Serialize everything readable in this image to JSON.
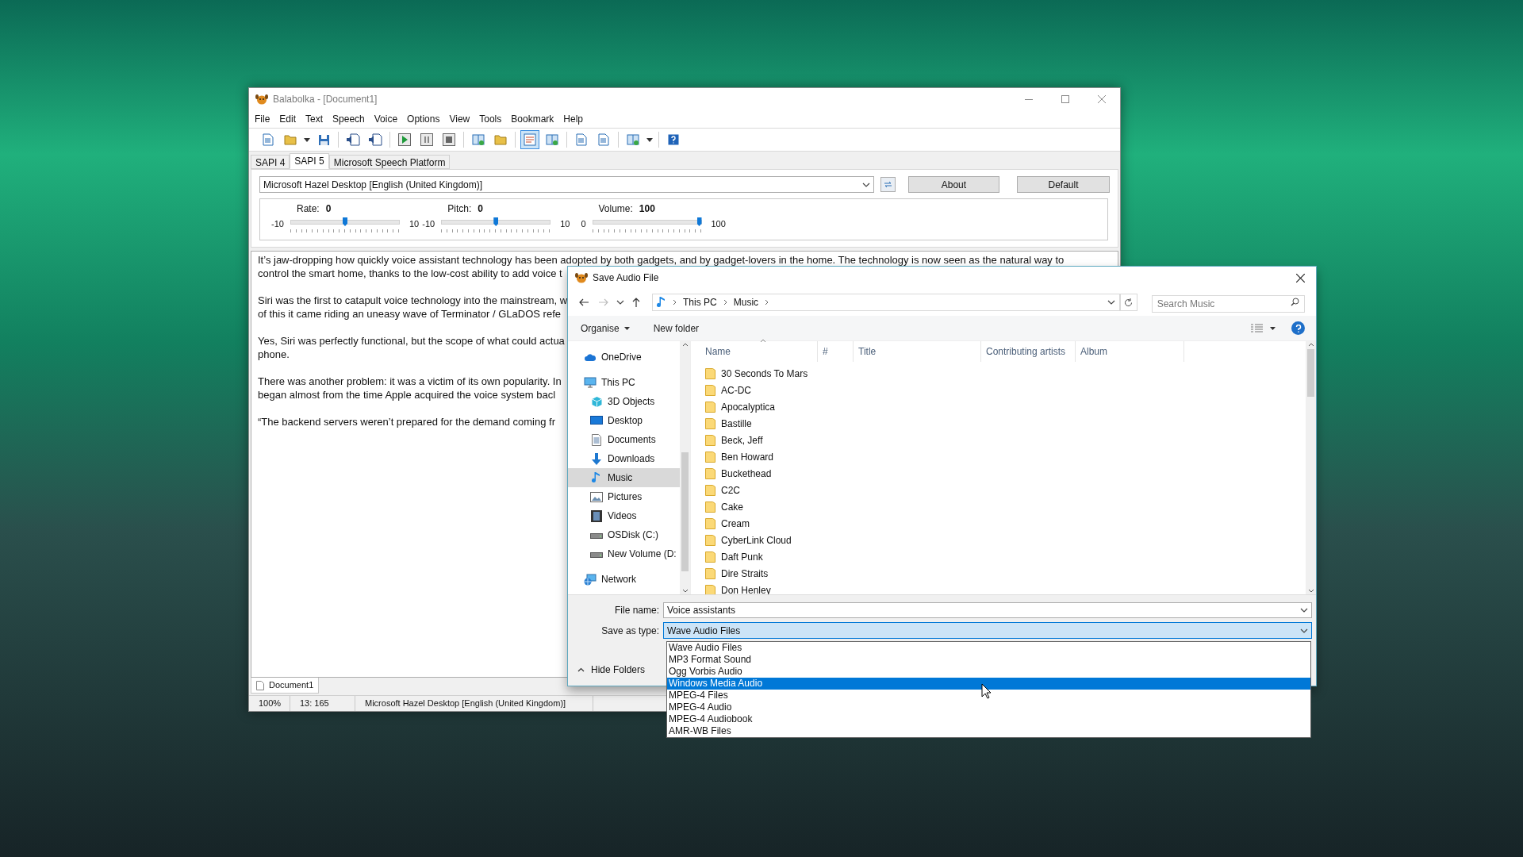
{
  "balabolka": {
    "title": "Balabolka - [Document1]",
    "menu": [
      "File",
      "Edit",
      "Text",
      "Speech",
      "Voice",
      "Options",
      "View",
      "Tools",
      "Bookmark",
      "Help"
    ],
    "toolbar": [
      {
        "kind": "page",
        "pressed": false
      },
      {
        "kind": "folder",
        "pressed": false
      },
      {
        "kind": "caret"
      },
      {
        "kind": "floppy",
        "pressed": false
      },
      {
        "kind": "sep"
      },
      {
        "kind": "page-speaker",
        "pressed": false
      },
      {
        "kind": "page-speaker",
        "pressed": false
      },
      {
        "kind": "sep"
      },
      {
        "kind": "play",
        "pressed": false
      },
      {
        "kind": "pause",
        "pressed": false
      },
      {
        "kind": "stop",
        "pressed": false
      },
      {
        "kind": "sep"
      },
      {
        "kind": "book",
        "pressed": false
      },
      {
        "kind": "folder",
        "pressed": false
      },
      {
        "kind": "sep"
      },
      {
        "kind": "panel",
        "pressed": true
      },
      {
        "kind": "book",
        "pressed": false
      },
      {
        "kind": "sep"
      },
      {
        "kind": "page",
        "pressed": false
      },
      {
        "kind": "page",
        "pressed": false
      },
      {
        "kind": "sep"
      },
      {
        "kind": "book",
        "pressed": false
      },
      {
        "kind": "caret"
      },
      {
        "kind": "sep"
      },
      {
        "kind": "help",
        "pressed": false
      }
    ],
    "engine_tabs": [
      {
        "label": "SAPI 4",
        "selected": false
      },
      {
        "label": "SAPI 5",
        "selected": true
      },
      {
        "label": "Microsoft Speech Platform",
        "selected": false
      }
    ],
    "voice": "Microsoft Hazel Desktop [English (United Kingdom)]",
    "buttons": [
      "About",
      "Default"
    ],
    "sliders": [
      {
        "label": "Rate:",
        "value": "0",
        "min": "-10",
        "max": "10",
        "level": 0.5
      },
      {
        "label": "Pitch:",
        "value": "0",
        "min": "-10",
        "max": "10",
        "level": 0.5
      },
      {
        "label": "Volume:",
        "value": "100",
        "min": "0",
        "max": "100",
        "level": 1
      }
    ],
    "text_paragraphs": [
      [
        "It’s jaw-dropping how quickly voice assistant technology has been adopted by both gadgets, and by gadget-lovers in the home. The technology is now seen as the natural way to",
        "control the smart home, thanks to the low-cost ability to add voice t"
      ],
      [
        "Siri was the first to catapult voice technology into the mainstream, w",
        "of this it came riding an uneasy wave of Terminator / GLaDOS refe"
      ],
      [
        "Yes, Siri was perfectly functional, but the scope of what could actua",
        "phone."
      ],
      [
        "There was another problem: it was a victim of its own popularity. In",
        "began almost from the time Apple acquired the voice system bacl"
      ],
      [
        "“The backend servers weren’t prepared for the demand coming fr"
      ]
    ],
    "document_tabs": [
      {
        "label": "Document1",
        "selected": true
      }
    ],
    "status_bar": [
      "100%",
      "13: 165",
      "Microsoft Hazel Desktop [English (United Kingdom)]"
    ]
  },
  "save_dialog": {
    "title": "Save Audio File",
    "breadcrumb": [
      "This PC",
      "Music"
    ],
    "search": {
      "placeholder": "Search Music"
    },
    "commands": [
      "Organise",
      "New folder"
    ],
    "sidebar": [
      {
        "label": "OneDrive",
        "kind": "cloud",
        "selected": false
      },
      {
        "label": "This PC",
        "kind": "computer",
        "selected": false,
        "children": [
          {
            "label": "3D Objects",
            "kind": "cube",
            "selected": false
          },
          {
            "label": "Desktop",
            "kind": "desktop",
            "selected": false
          },
          {
            "label": "Documents",
            "kind": "document",
            "selected": false
          },
          {
            "label": "Downloads",
            "kind": "download",
            "selected": false
          },
          {
            "label": "Music",
            "kind": "music",
            "selected": true
          },
          {
            "label": "Pictures",
            "kind": "picture",
            "selected": false
          },
          {
            "label": "Videos",
            "kind": "film",
            "selected": false
          },
          {
            "label": "OSDisk (C:)",
            "kind": "drive",
            "selected": false
          },
          {
            "label": "New Volume (D:",
            "kind": "drive",
            "selected": false
          }
        ]
      },
      {
        "label": "Network",
        "kind": "network",
        "selected": false
      }
    ],
    "columns": [
      "Name",
      "#",
      "Title",
      "Contributing artists",
      "Album"
    ],
    "folders": [
      "30 Seconds To Mars",
      "AC-DC",
      "Apocalyptica",
      "Bastille",
      "Beck, Jeff",
      "Ben Howard",
      "Buckethead",
      "C2C",
      "Cake",
      "Cream",
      "CyberLink Cloud",
      "Daft Punk",
      "Dire Straits",
      "Don Henley"
    ],
    "file_name_label": "File name:",
    "file_name": "Voice assistants",
    "type_label": "Save as type:",
    "save_type": "Wave Audio Files",
    "type_options": [
      {
        "label": "Wave Audio Files",
        "selected": false
      },
      {
        "label": "MP3 Format Sound",
        "selected": false
      },
      {
        "label": "Ogg Vorbis Audio",
        "selected": false
      },
      {
        "label": "Windows Media Audio",
        "selected": true
      },
      {
        "label": "MPEG-4 Files",
        "selected": false
      },
      {
        "label": "MPEG-4 Audio",
        "selected": false
      },
      {
        "label": "MPEG-4 Audiobook",
        "selected": false
      },
      {
        "label": "AMR-WB Files",
        "selected": false
      }
    ],
    "hide_folders": "Hide Folders"
  }
}
